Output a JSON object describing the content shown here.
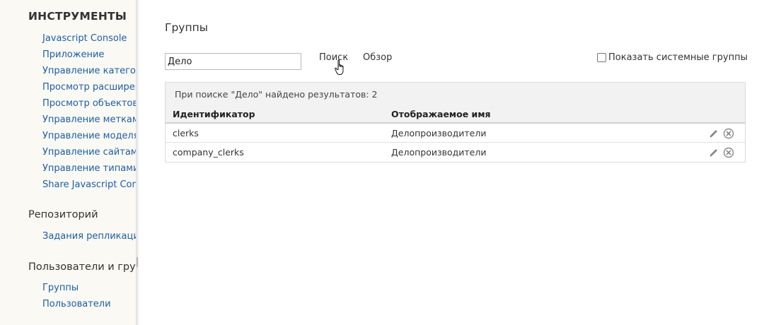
{
  "sidebar": {
    "tools_title": "ИНСТРУМЕНТЫ",
    "tools_items": [
      {
        "label": "Javascript Console"
      },
      {
        "label": "Приложение"
      },
      {
        "label": "Управление категор"
      },
      {
        "label": "Просмотр расширен"
      },
      {
        "label": "Просмотр объектов"
      },
      {
        "label": "Управление метками"
      },
      {
        "label": "Управление моделя"
      },
      {
        "label": "Управление сайтами"
      },
      {
        "label": "Управление типами"
      },
      {
        "label": "Share Javascript Cons"
      }
    ],
    "repo_title": "Репозиторий",
    "repo_items": [
      {
        "label": "Задания репликации"
      }
    ],
    "users_title": "Пользователи и групп",
    "users_items": [
      {
        "label": "Группы"
      },
      {
        "label": "Пользователи"
      }
    ]
  },
  "main": {
    "title": "Группы",
    "search_value": "Дело",
    "search_button": "Поиск",
    "browse_button": "Обзор",
    "show_system_groups": "Показать системные группы",
    "show_system_groups_checked": false,
    "results_summary": "При поиске \"Дело\" найдено результатов: 2",
    "columns": {
      "id": "Идентификатор",
      "display_name": "Отображаемое имя"
    },
    "rows": [
      {
        "id": "clerks",
        "display_name": "Делопроизводители"
      },
      {
        "id": "company_clerks",
        "display_name": "Делопроизводители"
      }
    ]
  },
  "colors": {
    "link": "#1a5ea8",
    "sidebar_bg": "#fbf9f4",
    "header_bg": "#f2f2f2"
  },
  "icons": [
    "edit-icon",
    "delete-icon",
    "hand-cursor-icon"
  ]
}
